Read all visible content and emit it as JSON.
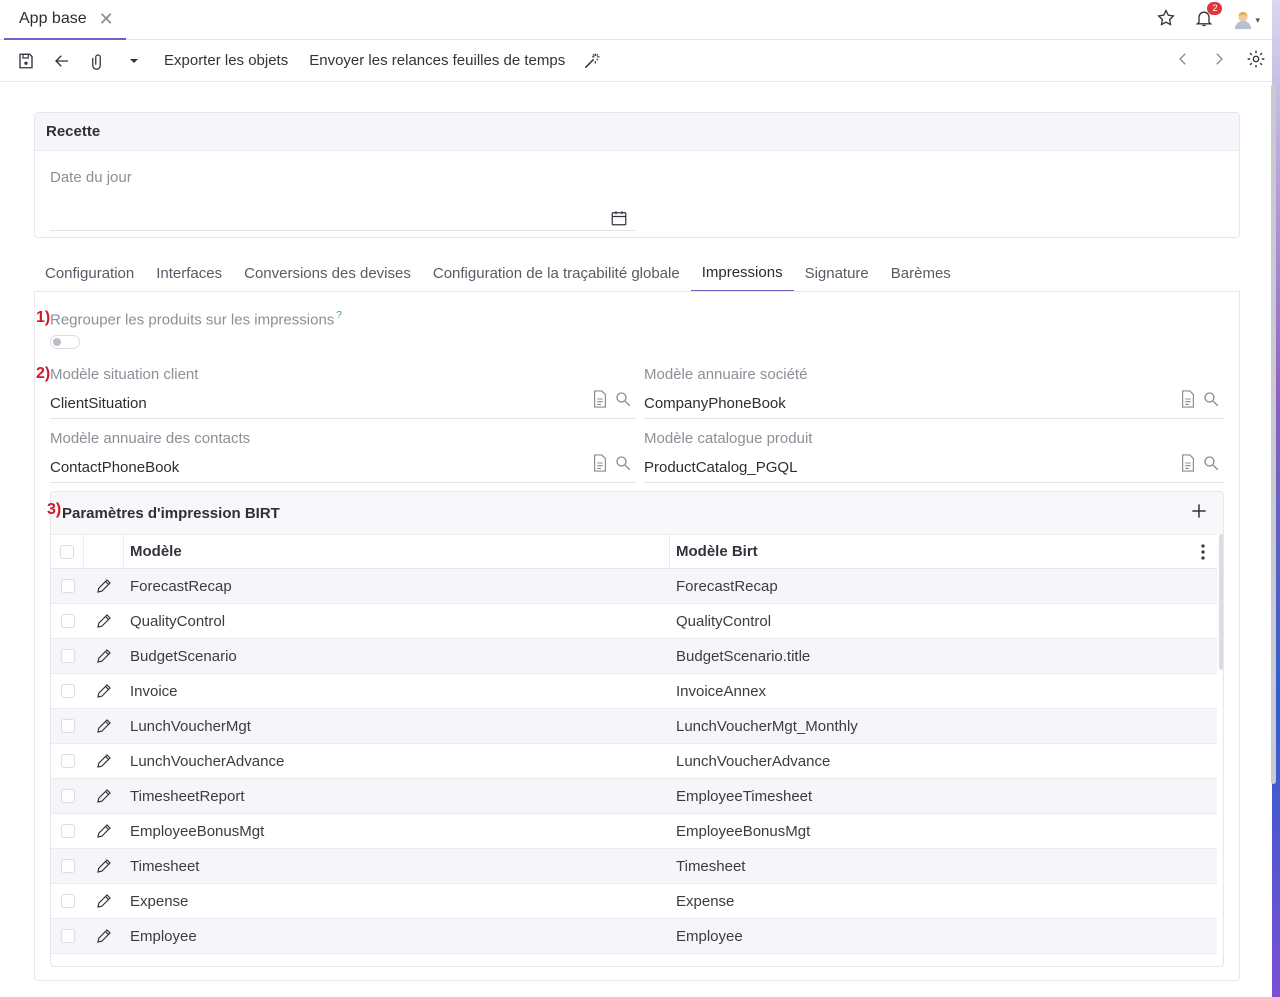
{
  "tab": {
    "title": "App base"
  },
  "notifications": {
    "count": "2"
  },
  "toolbar": {
    "export_label": "Exporter les objets",
    "reminder_label": "Envoyer les relances feuilles de temps"
  },
  "recette": {
    "title": "Recette",
    "date_label": "Date du jour",
    "date_value": ""
  },
  "tabs": [
    "Configuration",
    "Interfaces",
    "Conversions des devises",
    "Configuration de la traçabilité globale",
    "Impressions",
    "Signature",
    "Barèmes"
  ],
  "markers": {
    "m1": "1)",
    "m2": "2)",
    "m3": "3)"
  },
  "impressions": {
    "group_label": "Regrouper les produits sur les impressions",
    "help_mark": "?",
    "fields": {
      "client_situation": {
        "label": "Modèle situation client",
        "value": "ClientSituation"
      },
      "company_phonebook": {
        "label": "Modèle annuaire société",
        "value": "CompanyPhoneBook"
      },
      "contact_phonebook": {
        "label": "Modèle annuaire des contacts",
        "value": "ContactPhoneBook"
      },
      "product_catalog": {
        "label": "Modèle catalogue produit",
        "value": "ProductCatalog_PGQL"
      }
    },
    "birt": {
      "title": "Paramètres d'impression BIRT",
      "col_model": "Modèle",
      "col_birt": "Modèle Birt",
      "rows": [
        {
          "model": "ForecastRecap",
          "birt": "ForecastRecap"
        },
        {
          "model": "QualityControl",
          "birt": "QualityControl"
        },
        {
          "model": "BudgetScenario",
          "birt": "BudgetScenario.title"
        },
        {
          "model": "Invoice",
          "birt": "InvoiceAnnex"
        },
        {
          "model": "LunchVoucherMgt",
          "birt": "LunchVoucherMgt_Monthly"
        },
        {
          "model": "LunchVoucherAdvance",
          "birt": "LunchVoucherAdvance"
        },
        {
          "model": "TimesheetReport",
          "birt": "EmployeeTimesheet"
        },
        {
          "model": "EmployeeBonusMgt",
          "birt": "EmployeeBonusMgt"
        },
        {
          "model": "Timesheet",
          "birt": "Timesheet"
        },
        {
          "model": "Expense",
          "birt": "Expense"
        },
        {
          "model": "Employee",
          "birt": "Employee"
        }
      ]
    }
  },
  "colors": {
    "accent": "#6c63c7",
    "marker": "#d0182a",
    "badge": "#e0353a"
  }
}
